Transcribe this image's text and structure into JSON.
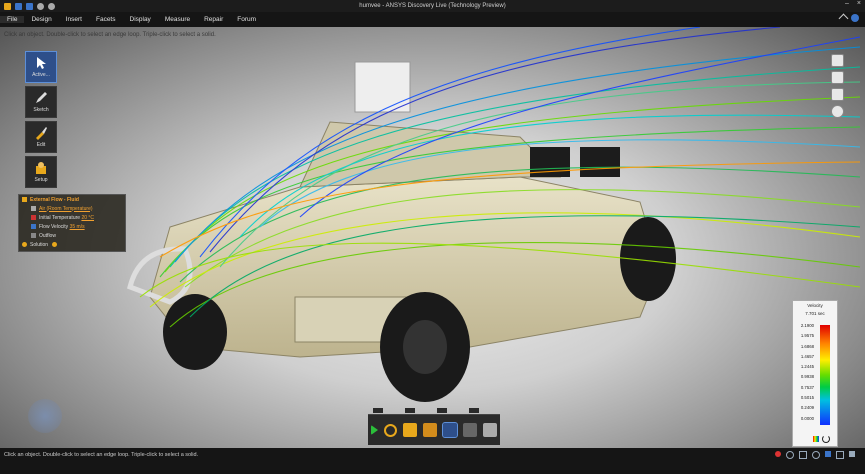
{
  "window": {
    "title": "humvee - ANSYS Discovery Live (Technology Preview)",
    "minimize": "–",
    "close": "×"
  },
  "menu": {
    "items": [
      "File",
      "Design",
      "Insert",
      "Facets",
      "Display",
      "Measure",
      "Repair",
      "Forum"
    ]
  },
  "viewport": {
    "hint": "Click an object. Double-click to select an edge loop. Triple-click to select a solid."
  },
  "tools": [
    {
      "label": "Active...",
      "icon": "cursor-icon"
    },
    {
      "label": "Sketch",
      "icon": "pencil-icon"
    },
    {
      "label": "Edit",
      "icon": "pull-icon"
    },
    {
      "label": "Setup",
      "icon": "setup-icon"
    }
  ],
  "tree": {
    "title": "External Flow - Fluid",
    "rows": [
      {
        "label": "Air (Room Temperature)",
        "style": "link"
      },
      {
        "label": "Initial Temperature",
        "value": "20 °C"
      },
      {
        "label": "Flow Velocity",
        "value": "35 m/s"
      },
      {
        "label": "Outflow"
      }
    ],
    "solution": "Solution"
  },
  "legend": {
    "title": "Velocity",
    "subtitle": "7.701 sec",
    "ticks": [
      "2.1900",
      "1.9575",
      "1.6868",
      "1.4657",
      "1.2445",
      "0.9938",
      "0.7537",
      "0.5015",
      "0.2409",
      "0.0000"
    ]
  },
  "status": {
    "message": "Click an object. Double-click to select an edge loop. Triple-click to select a solid."
  },
  "colors": {
    "accent": "#2e4f8a",
    "tree_link": "#f0a030"
  }
}
